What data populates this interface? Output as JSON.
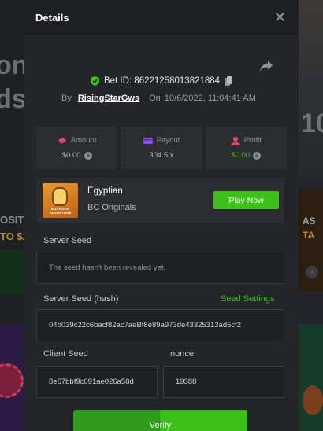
{
  "modal": {
    "title": "Details",
    "close_glyph": "✕",
    "bet_id": "Bet ID: 86221258013821884",
    "by_label": "By",
    "username": "RisingStarGws",
    "on_label": "On",
    "date": "10/6/2022, 11:04:41 AM"
  },
  "stats": {
    "amount_label": "Amount",
    "amount_value": "$0.00",
    "payout_label": "Payout",
    "payout_value": "304.5 x",
    "profit_label": "Profit",
    "profit_value": "$0.00"
  },
  "game": {
    "name": "Egyptian",
    "provider": "BC Originals",
    "thumb_text": "EGYPTIAN ADVENTURE",
    "play_label": "Play Now"
  },
  "seeds": {
    "server_seed_label": "Server Seed",
    "server_seed_value": "The seed hasn't been revealed yet.",
    "server_hash_label": "Server Seed (hash)",
    "seed_settings_label": "Seed Settings",
    "server_hash_value": "04b039c22c6bacf82ac7aeBf8e89a973de43325313ad5cf2",
    "client_seed_label": "Client Seed",
    "client_seed_value": "8e67bbf9c091ae026a58d",
    "nonce_label": "nonce",
    "nonce_value": "19388",
    "verify_label": "Verify"
  },
  "background": {
    "big_text_1": "on",
    "big_text_2": "ds",
    "deposit_1": "OSIT",
    "deposit_2": "TO $2",
    "right_1": "AS",
    "right_2": "TA",
    "jersey_number": "10"
  },
  "colors": {
    "accent_green": "#3bc117",
    "modal_bg": "#232529",
    "card_bg": "#2b2d31"
  },
  "icons": [
    "share-icon",
    "shield-check-icon",
    "copy-icon",
    "amount-icon",
    "payout-icon",
    "profit-icon",
    "coin-icon",
    "close-icon"
  ]
}
